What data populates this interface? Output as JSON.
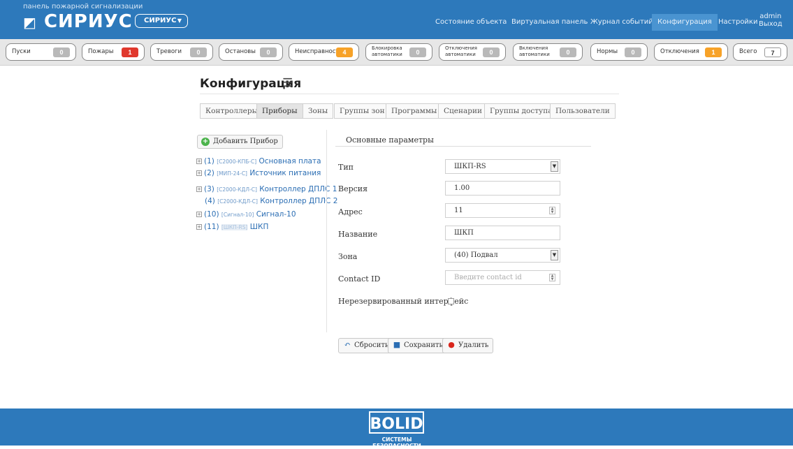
{
  "header": {
    "subtitle": "панель пожарной сигнализации",
    "app_name": "СИРИУС",
    "system_select": "СИРИУС",
    "nav": [
      "Состояние объекта",
      "Виртуальная панель",
      "Журнал событий",
      "Конфигурация",
      "Настройки"
    ],
    "active_nav": "Конфигурация",
    "user": "admin",
    "logout": "Выход"
  },
  "counters": [
    {
      "label": "Пуски",
      "value": "0"
    },
    {
      "label": "Пожары",
      "value": "1"
    },
    {
      "label": "Тревоги",
      "value": "0"
    },
    {
      "label": "Остановы",
      "value": "0"
    },
    {
      "label": "Неисправности",
      "value": "4"
    },
    {
      "label1": "Блокировка",
      "label2": "автоматики",
      "value": "0"
    },
    {
      "label1": "Отключения",
      "label2": "автоматики",
      "value": "0"
    },
    {
      "label1": "Включения",
      "label2": "автоматики",
      "value": "0"
    },
    {
      "label": "Нормы",
      "value": "0"
    },
    {
      "label": "Отключения",
      "value": "1"
    },
    {
      "label": "Всего",
      "value": "7"
    }
  ],
  "status_colors": {
    "fire": "#e0382d",
    "fault": "#f7a228",
    "zero": "#b9b9b9"
  },
  "page": {
    "title": "Конфигурация",
    "tabs": [
      "Контроллеры",
      "Приборы",
      "Зоны",
      "Группы зон",
      "Программы",
      "Сценарии",
      "Группы доступа",
      "Пользователи"
    ],
    "active_tab": "Приборы"
  },
  "tree": {
    "add_button": "Добавить Прибор",
    "items": [
      {
        "num": "(1)",
        "model": "[С2000-КПБ-С]",
        "name": "Основная плата"
      },
      {
        "num": "(2)",
        "model": "[МИП-24-С]",
        "name": "Источник питания"
      },
      {
        "num": "(3)",
        "model": "[С2000-КДЛ-С]",
        "name": "Контроллер ДПЛС 1"
      },
      {
        "num": "(4)",
        "model": "[С2000-КДЛ-С]",
        "name": "Контроллер ДПЛС 2"
      },
      {
        "num": "(10)",
        "model": "[Сигнал-10]",
        "name": "Сигнал-10"
      },
      {
        "num": "(11)",
        "model": "[ШКП-RS]",
        "name": "ШКП"
      }
    ]
  },
  "form": {
    "section": "Основные параметры",
    "type_label": "Тип",
    "type_value": "ШКП-RS",
    "version_label": "Версия",
    "version_value": "1.00",
    "address_label": "Адрес",
    "address_value": "11",
    "name_label": "Название",
    "name_value": "ШКП",
    "zone_label": "Зона",
    "zone_value": "(40) Подвал",
    "contact_label": "Contact ID",
    "contact_placeholder": "Введите contact id",
    "nonredundant_label": "Нерезервированный интерфейс",
    "reset": "Сбросить",
    "save": "Сохранить",
    "delete": "Удалить"
  },
  "footer": {
    "brand": "BOLID",
    "tagline": "СИСТЕМЫ БЕЗОПАСНОСТИ"
  }
}
